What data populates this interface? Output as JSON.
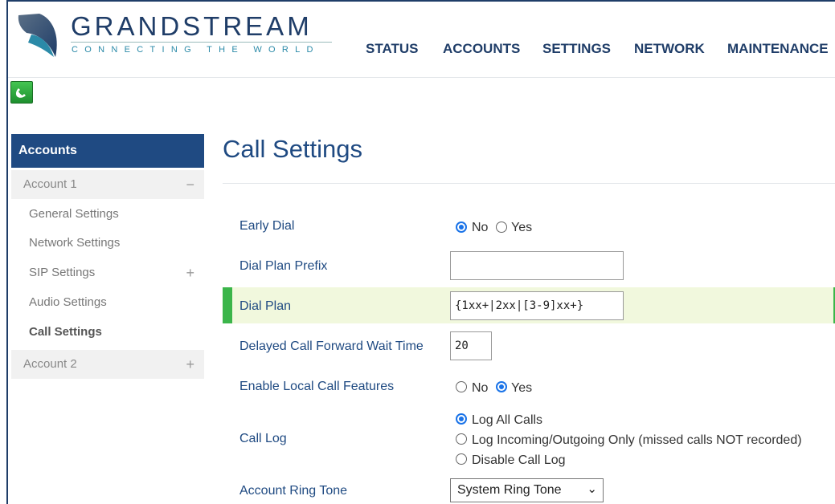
{
  "brand": {
    "name": "GRANDSTREAM",
    "tagline": "CONNECTING THE WORLD"
  },
  "topnav": [
    "STATUS",
    "ACCOUNTS",
    "SETTINGS",
    "NETWORK",
    "MAINTENANCE"
  ],
  "sidebar": {
    "header": "Accounts",
    "account1": {
      "label": "Account 1",
      "toggle": "−",
      "items": [
        {
          "label": "General Settings"
        },
        {
          "label": "Network Settings"
        },
        {
          "label": "SIP Settings",
          "toggle": "+"
        },
        {
          "label": "Audio Settings"
        },
        {
          "label": "Call Settings",
          "active": true
        }
      ]
    },
    "account2": {
      "label": "Account 2",
      "toggle": "+"
    }
  },
  "main": {
    "title": "Call Settings",
    "fields": {
      "early_dial": {
        "label": "Early Dial",
        "options": [
          "No",
          "Yes"
        ],
        "selected": "No"
      },
      "dial_plan_prefix": {
        "label": "Dial Plan Prefix",
        "value": ""
      },
      "dial_plan": {
        "label": "Dial Plan",
        "value": "{1xx+|2xx|[3-9]xx+}"
      },
      "delayed_forward": {
        "label": "Delayed Call Forward Wait Time",
        "value": "20"
      },
      "local_call_features": {
        "label": "Enable Local Call Features",
        "options": [
          "No",
          "Yes"
        ],
        "selected": "Yes"
      },
      "call_log": {
        "label": "Call Log",
        "options": [
          "Log All Calls",
          "Log Incoming/Outgoing Only (missed calls NOT recorded)",
          "Disable Call Log"
        ],
        "selected": "Log All Calls"
      },
      "ring_tone": {
        "label": "Account Ring Tone",
        "value": "System Ring Tone"
      }
    }
  },
  "colors": {
    "brand_navy": "#1f4a82",
    "highlight_row": "#f1f8dd",
    "highlight_bar": "#3bb54a",
    "radio_selected": "#1a73e8"
  },
  "icons": {
    "logo": "grandstream-logo-icon",
    "phone_status": "phone-icon",
    "collapse": "minus-icon",
    "expand": "plus-icon",
    "select_caret": "chevron-down-icon"
  }
}
